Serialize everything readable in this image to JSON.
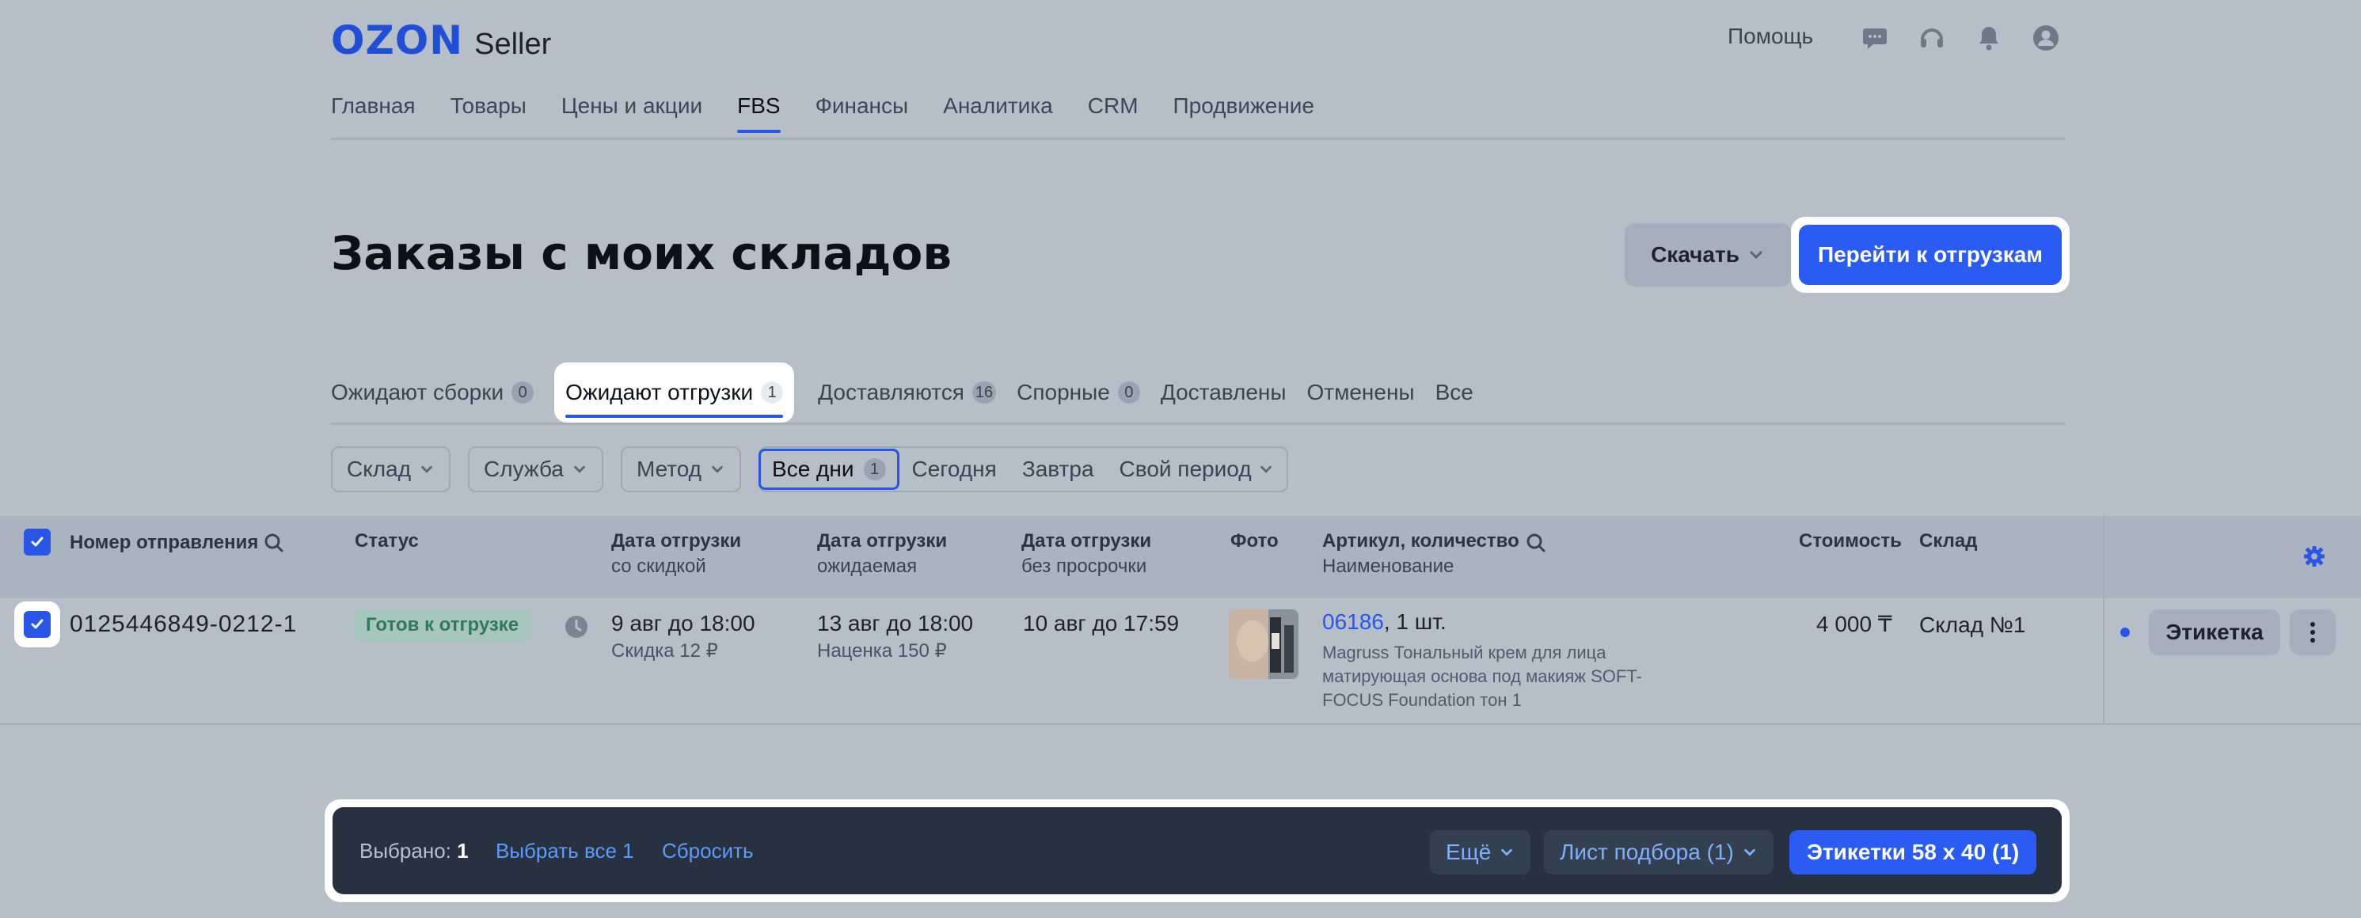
{
  "header": {
    "logo_ozon": "OZON",
    "logo_seller": "Seller",
    "help": "Помощь",
    "icons": [
      "chat-icon",
      "headset-icon",
      "bell-icon",
      "account-icon"
    ]
  },
  "nav": {
    "items": [
      "Главная",
      "Товары",
      "Цены и акции",
      "FBS",
      "Финансы",
      "Аналитика",
      "CRM",
      "Продвижение"
    ],
    "active": "FBS"
  },
  "page": {
    "title": "Заказы с моих складов",
    "download_label": "Скачать",
    "go_label": "Перейти к отгрузкам"
  },
  "tabs": [
    {
      "label": "Ожидают сборки",
      "count": "0"
    },
    {
      "label": "Ожидают отгрузки",
      "count": "1",
      "active": true
    },
    {
      "label": "Доставляются",
      "count": "16"
    },
    {
      "label": "Спорные",
      "count": "0"
    },
    {
      "label": "Доставлены",
      "count": ""
    },
    {
      "label": "Отменены",
      "count": ""
    },
    {
      "label": "Все",
      "count": ""
    }
  ],
  "filters": {
    "warehouse": "Склад",
    "service": "Служба",
    "method": "Метод",
    "all_days": "Все дни",
    "all_days_count": "1",
    "today": "Сегодня",
    "tomorrow": "Завтра",
    "custom": "Свой период"
  },
  "table": {
    "headers": {
      "number": "Номер отправления",
      "status": "Статус",
      "date1_a": "Дата отгрузки",
      "date1_b": "со скидкой",
      "date2_a": "Дата отгрузки",
      "date2_b": "ожидаемая",
      "date3_a": "Дата отгрузки",
      "date3_b": "без просрочки",
      "photo": "Фото",
      "article_a": "Артикул, количество",
      "article_b": "Наименование",
      "price": "Стоимость",
      "warehouse": "Склад"
    },
    "row": {
      "number": "0125446849-0212-1",
      "status": "Готов к отгрузке",
      "date1": "9 авг до 18:00",
      "date1_sub": "Скидка 12 ₽",
      "date2": "13 авг до 18:00",
      "date2_sub": "Наценка 150 ₽",
      "date3": "10 авг до 17:59",
      "article": "06186",
      "qty": ", 1 шт.",
      "name_1": "Magruss Тональный крем для лица",
      "name_2": "матирующая основа под макияж SOFT-",
      "name_3": "FOCUS Foundation тон 1",
      "price": "4 000 ₸",
      "warehouse": "Склад №1",
      "label_btn": "Этикетка"
    }
  },
  "bottom_bar": {
    "selected_label": "Выбрано:",
    "selected_count": "1",
    "select_all": "Выбрать все 1",
    "reset": "Сбросить",
    "more": "Ещё",
    "pick_list": "Лист подбора (1)",
    "labels": "Этикетки 58 x 40 (1)"
  },
  "colors": {
    "accent": "#2a5bf2",
    "status_ready_bg": "#a7c6bd",
    "status_ready_text": "#2d7a5e",
    "bar_bg": "#27313f"
  }
}
